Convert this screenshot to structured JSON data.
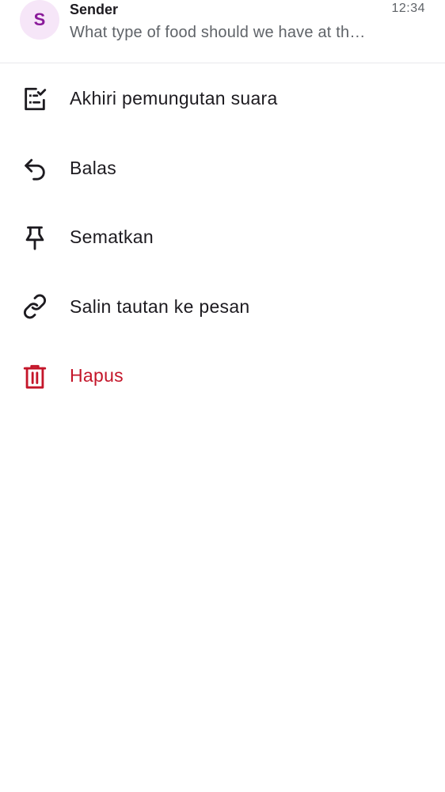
{
  "message": {
    "avatar_letter": "S",
    "sender": "Sender",
    "time": "12:34",
    "preview": "What type of food should we have at the party?"
  },
  "menu": {
    "items": [
      {
        "label": "Akhiri pemungutan suara",
        "icon": "poll-end-icon"
      },
      {
        "label": "Balas",
        "icon": "reply-icon"
      },
      {
        "label": "Sematkan",
        "icon": "pin-icon"
      },
      {
        "label": "Salin tautan ke pesan",
        "icon": "link-icon"
      },
      {
        "label": "Hapus",
        "icon": "trash-icon",
        "color": "#c4162a"
      }
    ]
  },
  "colors": {
    "accent_avatar_bg": "#f6e6f8",
    "accent_avatar_fg": "#8a1a9a",
    "danger": "#c4162a"
  }
}
